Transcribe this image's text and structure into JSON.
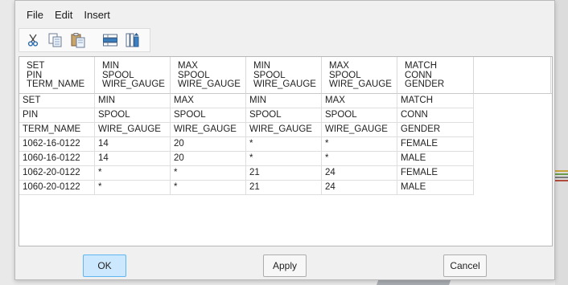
{
  "menu": {
    "items": [
      "File",
      "Edit",
      "Insert"
    ]
  },
  "toolbar": {
    "tools": [
      {
        "icon": "scissors-icon"
      },
      {
        "icon": "copy-icon"
      },
      {
        "icon": "paste-icon"
      },
      {
        "icon": "insert-row-icon"
      },
      {
        "icon": "insert-column-icon"
      }
    ]
  },
  "table": {
    "headers": [
      [
        "SET",
        "PIN",
        "TERM_NAME"
      ],
      [
        "MIN",
        "SPOOL",
        "WIRE_GAUGE"
      ],
      [
        "MAX",
        "SPOOL",
        "WIRE_GAUGE"
      ],
      [
        "MIN",
        "SPOOL",
        "WIRE_GAUGE"
      ],
      [
        "MAX",
        "SPOOL",
        "WIRE_GAUGE"
      ],
      [
        "MATCH",
        "CONN",
        "GENDER"
      ]
    ],
    "rows": [
      [
        "SET",
        "MIN",
        "MAX",
        "MIN",
        "MAX",
        "MATCH"
      ],
      [
        "PIN",
        "SPOOL",
        "SPOOL",
        "SPOOL",
        "SPOOL",
        "CONN"
      ],
      [
        "TERM_NAME",
        "WIRE_GAUGE",
        "WIRE_GAUGE",
        "WIRE_GAUGE",
        "WIRE_GAUGE",
        "GENDER"
      ],
      [
        "1062-16-0122",
        "14",
        "20",
        "*",
        "*",
        "FEMALE"
      ],
      [
        "1060-16-0122",
        "14",
        "20",
        "*",
        "*",
        "MALE"
      ],
      [
        "1062-20-0122",
        "*",
        "*",
        "21",
        "24",
        "FEMALE"
      ],
      [
        "1060-20-0122",
        "*",
        "*",
        "21",
        "24",
        "MALE"
      ]
    ]
  },
  "buttons": {
    "ok": "OK",
    "apply": "Apply",
    "cancel": "Cancel"
  },
  "colors": {
    "ok_bg": "#cce8ff",
    "ok_border": "#5fb6f0",
    "dialog_bg": "#f0f0f0"
  }
}
